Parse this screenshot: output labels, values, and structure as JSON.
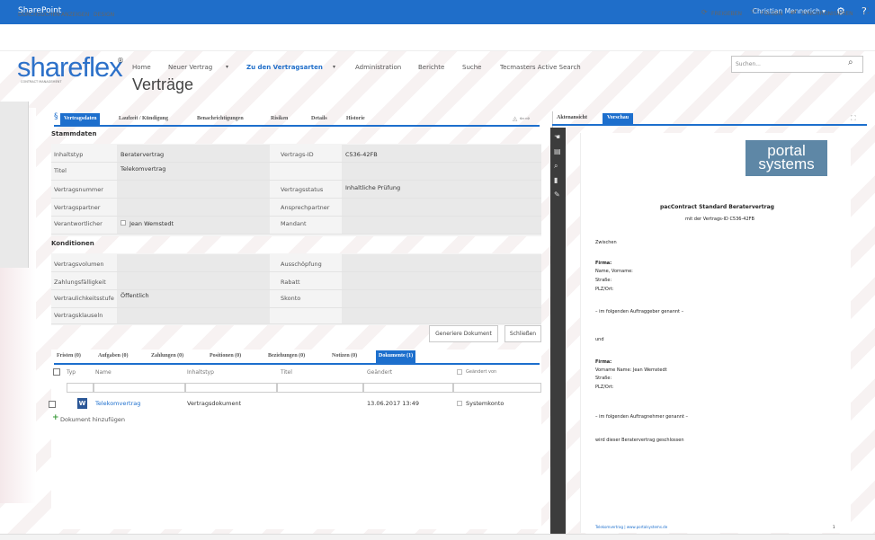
{
  "suite": {
    "title": "SharePoint",
    "user": "Christian Mennerich ▾"
  },
  "ribbon": {
    "left": [
      "DURCHSUCHEN",
      "ANZEIGEN",
      "DESIGN"
    ],
    "share": "FREIGEBEN",
    "follow": "FOLGEN",
    "sync": "SYNCHRONISIEREN"
  },
  "brand": {
    "logo": "shareflex",
    "sub": "CONTRACT MANAGEMENT"
  },
  "nav": [
    "Home",
    "Neuer Vertrag",
    "Zu den Vertragsarten",
    "Administration",
    "Berichte",
    "Suche",
    "Tecmasters Active Search"
  ],
  "page_title": "Verträge",
  "search": {
    "placeholder": "Suchen..."
  },
  "tabs": [
    "Vertragsdaten",
    "Laufzeit / Kündigung",
    "Benachrichtigungen",
    "Risiken",
    "Details",
    "Historie"
  ],
  "sections": {
    "stammdaten": "Stammdaten",
    "konditionen": "Konditionen"
  },
  "fields": {
    "inhaltstyp": {
      "label": "Inhaltstyp",
      "value": "Beratervertrag"
    },
    "vertrags_id": {
      "label": "Vertrags-ID",
      "value": "C536-42FB"
    },
    "titel": {
      "label": "Titel",
      "value": "Telekomvertrag"
    },
    "vertragsnummer": {
      "label": "Vertragsnummer",
      "value": ""
    },
    "vertragsstatus": {
      "label": "Vertragsstatus",
      "value": "Inhaltliche Prüfung"
    },
    "vertragspartner": {
      "label": "Vertragspartner",
      "value": ""
    },
    "ansprechpartner": {
      "label": "Ansprechpartner",
      "value": ""
    },
    "verantwortlicher": {
      "label": "Verantwortlicher",
      "value": "Jean Wemstedt"
    },
    "mandant": {
      "label": "Mandant",
      "value": ""
    },
    "vertragsvolumen": {
      "label": "Vertragsvolumen",
      "value": ""
    },
    "ausschoepfung": {
      "label": "Ausschöpfung",
      "value": ""
    },
    "zahlungsfaelligkeit": {
      "label": "Zahlungsfälligkeit",
      "value": ""
    },
    "rabatt": {
      "label": "Rabatt",
      "value": ""
    },
    "vertraulichkeit": {
      "label": "Vertraulichkeitsstufe",
      "value": "Öffentlich"
    },
    "skonto": {
      "label": "Skonto",
      "value": ""
    },
    "klauseln": {
      "label": "Vertragsklauseln",
      "value": ""
    }
  },
  "buttons": {
    "generate": "Generiere Dokument",
    "close": "Schließen"
  },
  "tabs2": [
    "Fristen (0)",
    "Aufgaben (0)",
    "Zahlungen (0)",
    "Positionen (0)",
    "Beziehungen (0)",
    "Notizen (0)",
    "Dokumente (1)"
  ],
  "doc_table": {
    "headers": [
      "Typ",
      "Name",
      "Inhaltstyp",
      "Titel",
      "Geändert",
      "Geändert von"
    ],
    "row": {
      "name": "Telekomvertrag",
      "inhaltstyp": "Vertragsdokument",
      "geaendert": "13.06.2017 13:49",
      "geaendert_von": "Systemkonto"
    },
    "add": "Dokument hinzufügen"
  },
  "right": {
    "tabs": [
      "Aktenansicht",
      "Vorschau"
    ]
  },
  "doc": {
    "logo1": "portal",
    "logo2": "systems",
    "title": "pacContract Standard Beratervertrag",
    "subtitle": "mit der Vertrags-ID C536-42FB",
    "zwischen": "Zwischen",
    "firma": "Firma:",
    "name_vorname": "Name, Vorname:",
    "strasse": "Straße:",
    "plz": "PLZ/Ort:",
    "auftraggeber": "– im folgenden Auftraggeber genannt –",
    "und": "und",
    "firma2": "Firma:",
    "name2": "Vorname Name:   Jean Wemstedt",
    "strasse2": "Straße:",
    "plz2": "PLZ/Ort:",
    "auftragnehmer": "– im folgenden Auftragnehmer genannt –",
    "wird": "wird dieser  Beratervertrag  geschlossen",
    "footer": "Telekomvertrag | www.portalsystems.de",
    "pagenum": "1"
  }
}
